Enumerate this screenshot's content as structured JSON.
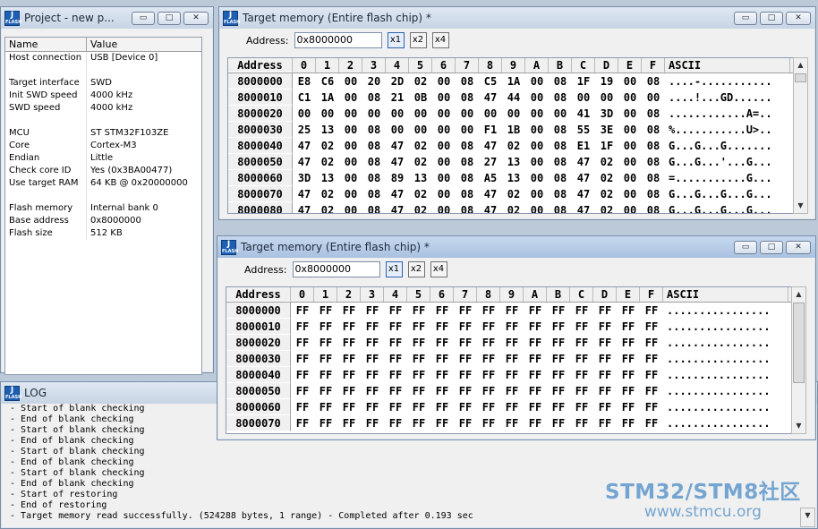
{
  "project": {
    "title": "Project - new p...",
    "col_name": "Name",
    "col_value": "Value",
    "rows": [
      {
        "k": "Host connection",
        "v": "USB [Device 0]"
      },
      {
        "k": "",
        "v": ""
      },
      {
        "k": "Target interface",
        "v": "SWD"
      },
      {
        "k": "Init SWD speed",
        "v": "4000 kHz"
      },
      {
        "k": "SWD speed",
        "v": "4000 kHz"
      },
      {
        "k": "",
        "v": ""
      },
      {
        "k": "MCU",
        "v": "ST STM32F103ZE"
      },
      {
        "k": "Core",
        "v": "Cortex-M3"
      },
      {
        "k": "Endian",
        "v": "Little"
      },
      {
        "k": "Check core ID",
        "v": "Yes (0x3BA00477)"
      },
      {
        "k": "Use target RAM",
        "v": "64 KB @ 0x20000000"
      },
      {
        "k": "",
        "v": ""
      },
      {
        "k": "Flash memory",
        "v": "Internal bank 0"
      },
      {
        "k": "Base address",
        "v": "0x8000000"
      },
      {
        "k": "Flash size",
        "v": "512 KB"
      }
    ]
  },
  "mem1": {
    "title": "Target memory (Entire flash chip) *",
    "address_label": "Address:",
    "address_value": "0x8000000",
    "zoom": [
      "x1",
      "x2",
      "x4"
    ],
    "header_address": "Address",
    "header_cols": [
      "0",
      "1",
      "2",
      "3",
      "4",
      "5",
      "6",
      "7",
      "8",
      "9",
      "A",
      "B",
      "C",
      "D",
      "E",
      "F"
    ],
    "header_ascii": "ASCII",
    "rows": [
      {
        "addr": "8000000",
        "bytes": [
          "E8",
          "C6",
          "00",
          "20",
          "2D",
          "02",
          "00",
          "08",
          "C5",
          "1A",
          "00",
          "08",
          "1F",
          "19",
          "00",
          "08"
        ],
        "ascii": "....-..........."
      },
      {
        "addr": "8000010",
        "bytes": [
          "C1",
          "1A",
          "00",
          "08",
          "21",
          "0B",
          "00",
          "08",
          "47",
          "44",
          "00",
          "08",
          "00",
          "00",
          "00",
          "00"
        ],
        "ascii": "....!...GD......"
      },
      {
        "addr": "8000020",
        "bytes": [
          "00",
          "00",
          "00",
          "00",
          "00",
          "00",
          "00",
          "00",
          "00",
          "00",
          "00",
          "00",
          "41",
          "3D",
          "00",
          "08"
        ],
        "ascii": "............A=.."
      },
      {
        "addr": "8000030",
        "bytes": [
          "25",
          "13",
          "00",
          "08",
          "00",
          "00",
          "00",
          "00",
          "F1",
          "1B",
          "00",
          "08",
          "55",
          "3E",
          "00",
          "08"
        ],
        "ascii": "%...........U>.."
      },
      {
        "addr": "8000040",
        "bytes": [
          "47",
          "02",
          "00",
          "08",
          "47",
          "02",
          "00",
          "08",
          "47",
          "02",
          "00",
          "08",
          "E1",
          "1F",
          "00",
          "08"
        ],
        "ascii": "G...G...G......."
      },
      {
        "addr": "8000050",
        "bytes": [
          "47",
          "02",
          "00",
          "08",
          "47",
          "02",
          "00",
          "08",
          "27",
          "13",
          "00",
          "08",
          "47",
          "02",
          "00",
          "08"
        ],
        "ascii": "G...G...'...G..."
      },
      {
        "addr": "8000060",
        "bytes": [
          "3D",
          "13",
          "00",
          "08",
          "89",
          "13",
          "00",
          "08",
          "A5",
          "13",
          "00",
          "08",
          "47",
          "02",
          "00",
          "08"
        ],
        "ascii": "=...........G..."
      },
      {
        "addr": "8000070",
        "bytes": [
          "47",
          "02",
          "00",
          "08",
          "47",
          "02",
          "00",
          "08",
          "47",
          "02",
          "00",
          "08",
          "47",
          "02",
          "00",
          "08"
        ],
        "ascii": "G...G...G...G..."
      },
      {
        "addr": "8000080",
        "bytes": [
          "47",
          "02",
          "00",
          "08",
          "47",
          "02",
          "00",
          "08",
          "47",
          "02",
          "00",
          "08",
          "47",
          "02",
          "00",
          "08"
        ],
        "ascii": "G...G...G...G..."
      }
    ]
  },
  "mem2": {
    "title": "Target memory (Entire flash chip) *",
    "address_label": "Address:",
    "address_value": "0x8000000",
    "zoom": [
      "x1",
      "x2",
      "x4"
    ],
    "header_address": "Address",
    "header_cols": [
      "0",
      "1",
      "2",
      "3",
      "4",
      "5",
      "6",
      "7",
      "8",
      "9",
      "A",
      "B",
      "C",
      "D",
      "E",
      "F"
    ],
    "header_ascii": "ASCII",
    "rows": [
      {
        "addr": "8000000",
        "bytes": [
          "FF",
          "FF",
          "FF",
          "FF",
          "FF",
          "FF",
          "FF",
          "FF",
          "FF",
          "FF",
          "FF",
          "FF",
          "FF",
          "FF",
          "FF",
          "FF"
        ],
        "ascii": "................"
      },
      {
        "addr": "8000010",
        "bytes": [
          "FF",
          "FF",
          "FF",
          "FF",
          "FF",
          "FF",
          "FF",
          "FF",
          "FF",
          "FF",
          "FF",
          "FF",
          "FF",
          "FF",
          "FF",
          "FF"
        ],
        "ascii": "................"
      },
      {
        "addr": "8000020",
        "bytes": [
          "FF",
          "FF",
          "FF",
          "FF",
          "FF",
          "FF",
          "FF",
          "FF",
          "FF",
          "FF",
          "FF",
          "FF",
          "FF",
          "FF",
          "FF",
          "FF"
        ],
        "ascii": "................"
      },
      {
        "addr": "8000030",
        "bytes": [
          "FF",
          "FF",
          "FF",
          "FF",
          "FF",
          "FF",
          "FF",
          "FF",
          "FF",
          "FF",
          "FF",
          "FF",
          "FF",
          "FF",
          "FF",
          "FF"
        ],
        "ascii": "................"
      },
      {
        "addr": "8000040",
        "bytes": [
          "FF",
          "FF",
          "FF",
          "FF",
          "FF",
          "FF",
          "FF",
          "FF",
          "FF",
          "FF",
          "FF",
          "FF",
          "FF",
          "FF",
          "FF",
          "FF"
        ],
        "ascii": "................"
      },
      {
        "addr": "8000050",
        "bytes": [
          "FF",
          "FF",
          "FF",
          "FF",
          "FF",
          "FF",
          "FF",
          "FF",
          "FF",
          "FF",
          "FF",
          "FF",
          "FF",
          "FF",
          "FF",
          "FF"
        ],
        "ascii": "................"
      },
      {
        "addr": "8000060",
        "bytes": [
          "FF",
          "FF",
          "FF",
          "FF",
          "FF",
          "FF",
          "FF",
          "FF",
          "FF",
          "FF",
          "FF",
          "FF",
          "FF",
          "FF",
          "FF",
          "FF"
        ],
        "ascii": "................"
      },
      {
        "addr": "8000070",
        "bytes": [
          "FF",
          "FF",
          "FF",
          "FF",
          "FF",
          "FF",
          "FF",
          "FF",
          "FF",
          "FF",
          "FF",
          "FF",
          "FF",
          "FF",
          "FF",
          "FF"
        ],
        "ascii": "................"
      }
    ]
  },
  "log": {
    "title": "LOG",
    "lines": [
      " - Start of blank checking",
      " - End of blank checking",
      " - Start of blank checking",
      " - End of blank checking",
      " - Start of blank checking",
      " - End of blank checking",
      " - Start of blank checking",
      " - End of blank checking",
      " - Start of restoring",
      " - End of restoring",
      " - Target memory read successfully. (524288 bytes, 1 range) - Completed after 0.193 sec"
    ]
  },
  "watermark": {
    "line1": "STM32/STM8社区",
    "line2": "www.stmcu.org"
  },
  "logo": {
    "line1": "J",
    "line2": "FLASH"
  },
  "window_buttons": {
    "minimize": "▭",
    "maximize": "□",
    "close": "✕"
  }
}
